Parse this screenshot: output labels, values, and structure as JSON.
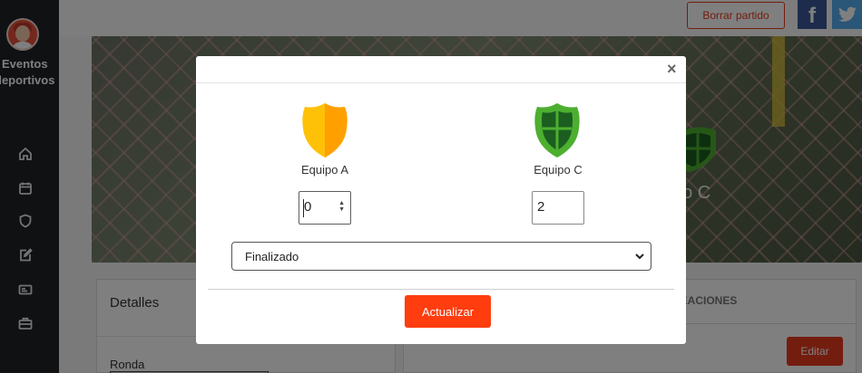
{
  "sidebar": {
    "brand_line1": "Eventos",
    "brand_line2": "deportivos",
    "nav": [
      {
        "icon": "home-icon"
      },
      {
        "icon": "calendar-icon"
      },
      {
        "icon": "shield-icon"
      },
      {
        "icon": "edit-icon"
      },
      {
        "icon": "id-card-icon"
      },
      {
        "icon": "briefcase-icon"
      }
    ]
  },
  "topbar": {
    "delete_label": "Borrar partido",
    "facebook_glyph": "f",
    "twitter_icon": "twitter-icon"
  },
  "hero": {
    "team_partial": "po C",
    "crest_color": "#4caf2f"
  },
  "panels": {
    "details_title": "Detalles",
    "round_label": "Ronda",
    "lineups_tab": "NEACIONES",
    "edit_label": "Editar"
  },
  "modal": {
    "close_glyph": "×",
    "home_team": {
      "name": "Equipo A",
      "score": "0",
      "crest_color": "#ffc107"
    },
    "away_team": {
      "name": "Equipo C",
      "score": "2",
      "crest_color": "#4caf2f"
    },
    "status_value": "Finalizado",
    "update_label": "Actualizar"
  },
  "colors": {
    "accent": "#ff3d0f",
    "sidebar": "#1e2226"
  }
}
